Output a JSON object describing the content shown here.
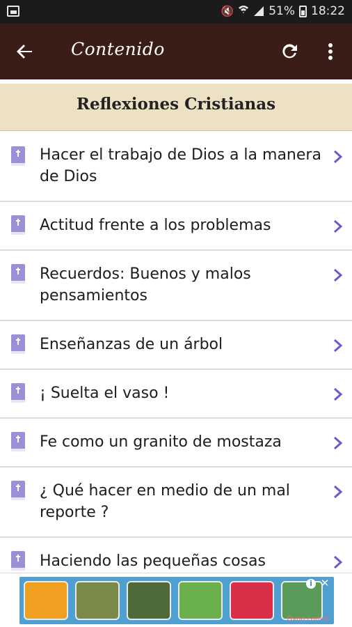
{
  "status_bar": {
    "battery_percent": "51%",
    "time": "18:22"
  },
  "app_bar": {
    "title": "Contenido",
    "icons": [
      "back-arrow-icon",
      "refresh-icon",
      "more-vertical-icon"
    ]
  },
  "section": {
    "title": "Reflexiones Cristianas"
  },
  "list": {
    "items": [
      {
        "label": "Hacer el trabajo de Dios a la manera de Dios"
      },
      {
        "label": "Actitud frente a los problemas"
      },
      {
        "label": "Recuerdos: Buenos y malos pensamientos"
      },
      {
        "label": "Enseñanzas de un árbol"
      },
      {
        "label": "¡ Suelta el vaso !"
      },
      {
        "label": "Fe como un granito de mostaza"
      },
      {
        "label": "¿ Qué hacer en medio de un mal reporte ?"
      },
      {
        "label": "Haciendo las pequeñas cosas"
      }
    ]
  },
  "ad": {
    "info_label": "i",
    "close_label": "✕",
    "domain": "Qvoo.com.tr"
  },
  "colors": {
    "status_bar": "#1b1b1b",
    "app_bar": "#3a1d17",
    "section_header": "#ece1c2",
    "chevron": "#6a5acd",
    "book_icon": "#9b8fd6"
  }
}
